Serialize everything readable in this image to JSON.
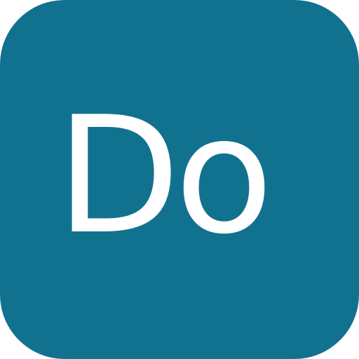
{
  "app_icon": {
    "label": "Do",
    "background_color": "#11728f",
    "text_color": "#ffffff"
  }
}
